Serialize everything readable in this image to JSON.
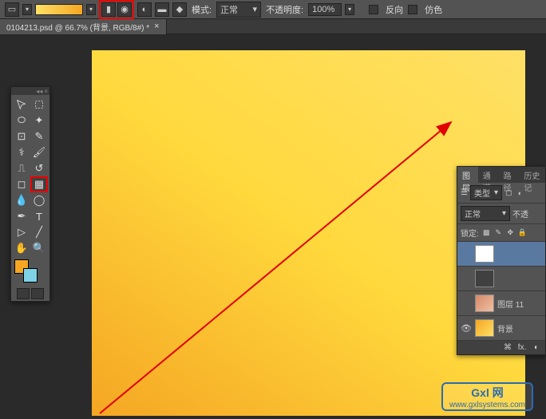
{
  "options_bar": {
    "mode_label": "模式:",
    "mode_value": "正常",
    "opacity_label": "不透明度:",
    "opacity_value": "100%",
    "reverse_label": "反向",
    "dither_label": "仿色"
  },
  "document": {
    "tab_title": "0104213.psd @ 66.7% (背景, RGB/8#) *"
  },
  "layers_panel": {
    "tabs": [
      "图层",
      "通道",
      "路径",
      "历史记"
    ],
    "filter_label": "类型",
    "blend_mode": "正常",
    "opacity_partial": "不透",
    "lock_label": "锁定:",
    "layers": [
      {
        "name": "",
        "visible": false,
        "selected": true,
        "thumb": "white"
      },
      {
        "name": "",
        "visible": false,
        "selected": false,
        "thumb": "solid"
      },
      {
        "name": "图层 11",
        "visible": false,
        "selected": false,
        "thumb": "photo"
      },
      {
        "name": "背景",
        "visible": true,
        "selected": false,
        "thumb": "gradient"
      }
    ],
    "footer_fx": "fx."
  },
  "watermark": {
    "logo": "Gxl 网",
    "url": "www.gxlsystems.com"
  },
  "chart_data": null
}
